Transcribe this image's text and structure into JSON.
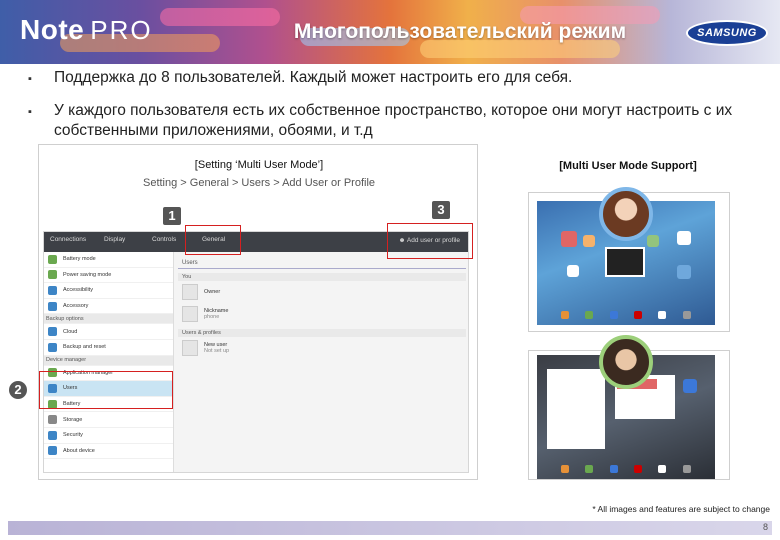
{
  "header": {
    "logo": "Note",
    "logo_suffix": "PRO",
    "title": "Многопользовательский режим",
    "brand": "SAMSUNG"
  },
  "bullets": [
    {
      "mark": "▪",
      "text": "Поддержка до 8 пользователей. Каждый может настроить его для себя."
    },
    {
      "mark": "▪",
      "text": "У каждого пользователя есть их собственное пространство, которое они могут настроить с их собственными приложениями, обоями, и т.д"
    }
  ],
  "left_figure": {
    "caption": "[Setting ‘Multi User Mode’]",
    "path": "Setting > General > Users > Add User or Profile",
    "markers": [
      "1",
      "2",
      "3"
    ],
    "tabs": [
      "Connections",
      "Display",
      "Controls",
      "General"
    ],
    "add_button": "Add user or profile",
    "left_items": [
      {
        "label": "Battery mode",
        "color": "#6aa84f",
        "head": false
      },
      {
        "label": "Power saving mode",
        "color": "#6aa84f",
        "head": false
      },
      {
        "label": "Accessibility",
        "color": "#3d85c6",
        "head": false
      },
      {
        "label": "Accessory",
        "color": "#3d85c6",
        "head": false
      },
      {
        "label": "Backup options",
        "color": "",
        "head": true
      },
      {
        "label": "Cloud",
        "color": "#3d85c6",
        "head": false
      },
      {
        "label": "Backup and reset",
        "color": "#3d85c6",
        "head": false
      },
      {
        "label": "Device manager",
        "color": "",
        "head": true
      },
      {
        "label": "Application manager",
        "color": "#6aa84f",
        "head": false
      },
      {
        "label": "Users",
        "color": "#3d85c6",
        "head": false,
        "selected": true
      },
      {
        "label": "Battery",
        "color": "#6aa84f",
        "head": false
      },
      {
        "label": "Storage",
        "color": "#888888",
        "head": false
      },
      {
        "label": "Security",
        "color": "#3d85c6",
        "head": false
      },
      {
        "label": "About device",
        "color": "#3d85c6",
        "head": false
      }
    ],
    "right_title": "Users",
    "sections": [
      {
        "head": "You",
        "users": [
          {
            "name": "Owner",
            "sub": ""
          }
        ]
      },
      {
        "head": "",
        "users": [
          {
            "name": "Nickname",
            "sub": "phone"
          }
        ]
      },
      {
        "head": "Users & profiles",
        "users": [
          {
            "name": "New user",
            "sub": "Not set up"
          }
        ]
      }
    ]
  },
  "right_figure": {
    "caption": "[Multi User Mode Support]"
  },
  "footer": {
    "note": "* All images and features are subject to change",
    "page": "8"
  },
  "colors": {
    "accent_red": "#d52020",
    "brand_blue": "#1a3f95",
    "tabbar": "#3d4046",
    "selected_row": "#c9e4f3"
  }
}
